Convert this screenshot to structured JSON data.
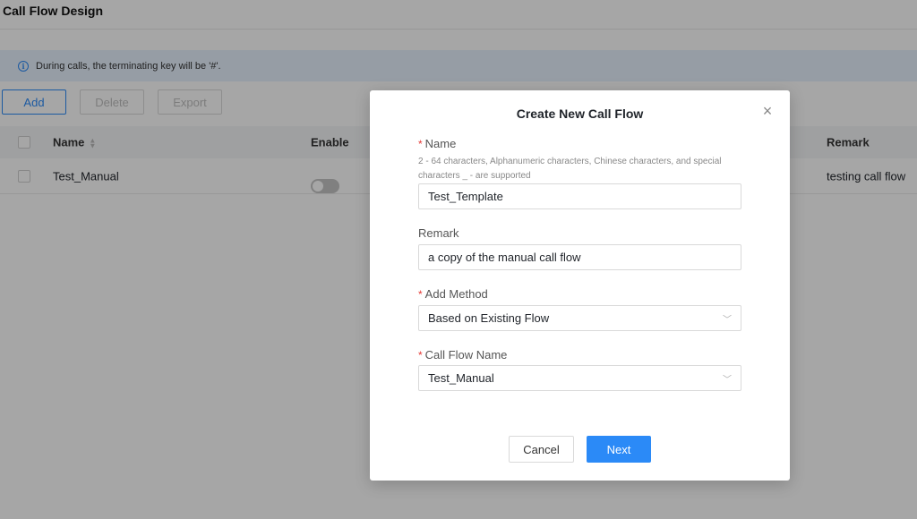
{
  "page": {
    "title": "Call Flow Design",
    "info_text": "During calls, the terminating key will be '#'.",
    "info_icon": "info-icon"
  },
  "toolbar": {
    "add_label": "Add",
    "delete_label": "Delete",
    "export_label": "Export"
  },
  "table": {
    "columns": [
      "Name",
      "Enable",
      "Remark"
    ],
    "rows": [
      {
        "name": "Test_Manual",
        "enabled": false,
        "remark": "testing call flow"
      }
    ]
  },
  "modal": {
    "title": "Create New Call Flow",
    "name_label": "Name",
    "name_help": "2 - 64 characters, Alphanumeric characters, Chinese characters, and special characters _ - are supported",
    "name_value": "Test_Template",
    "remark_label": "Remark",
    "remark_value": "a copy of the manual call flow",
    "method_label": "Add Method",
    "method_value": "Based on Existing Flow",
    "flow_label": "Call Flow Name",
    "flow_value": "Test_Manual",
    "cancel_label": "Cancel",
    "next_label": "Next",
    "required_mark": "*"
  },
  "colors": {
    "accent": "#2b8af7",
    "info_bg": "#e6f1fd",
    "required": "#e53935"
  }
}
